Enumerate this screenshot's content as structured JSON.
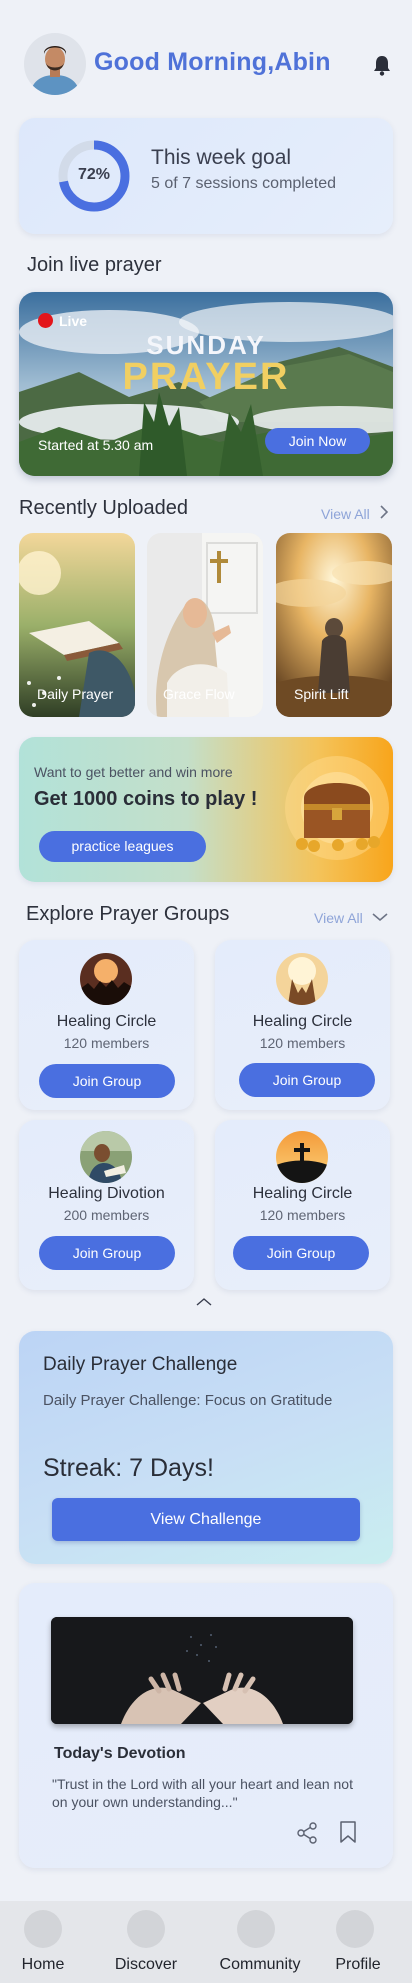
{
  "header": {
    "greeting": "Good Morning,Abin",
    "icons": {
      "avatar": "user-avatar",
      "bell": "bell-icon"
    },
    "accent_color": "#4f72d8"
  },
  "goal": {
    "percent_label": "72%",
    "progress": 0.72,
    "title": "This week goal",
    "subtitle": "5 of 7 sessions completed"
  },
  "live_prayer": {
    "section_title": "Join live prayer",
    "badge": "Live",
    "banner_line1": "SUNDAY",
    "banner_line2": "PRAYER",
    "started": "Started at 5.30 am",
    "join_label": "Join Now"
  },
  "recent": {
    "section_title": "Recently Uploaded",
    "view_all": "View All",
    "items": [
      {
        "label": "Daily Prayer"
      },
      {
        "label": "Grace Flow"
      },
      {
        "label": "Spirit Lift"
      }
    ]
  },
  "coins": {
    "small_text": "Want to get better and win more",
    "big_text": "Get 1000 coins to play !",
    "button_label": "practice leagues"
  },
  "groups": {
    "section_title": "Explore Prayer Groups",
    "view_all": "View All",
    "items": [
      {
        "name": "Healing Circle",
        "members": "120 members",
        "button": "Join Group"
      },
      {
        "name": "Healing Circle",
        "members": "120 members",
        "button": "Join Group"
      },
      {
        "name": "Healing Divotion",
        "members": "200 members",
        "button": "Join Group"
      },
      {
        "name": "Healing Circle",
        "members": "120 members",
        "button": "Join Group"
      }
    ]
  },
  "challenge": {
    "title": "Daily Prayer Challenge",
    "subtitle": "Daily Prayer Challenge: Focus on Gratitude",
    "streak": "Streak: 7 Days!",
    "button_label": "View Challenge"
  },
  "devotion": {
    "title": "Today's Devotion",
    "quote": "\"Trust in the Lord with all your heart and lean not on your own understanding...\""
  },
  "nav": {
    "items": [
      {
        "label": "Home"
      },
      {
        "label": "Discover"
      },
      {
        "label": "Community"
      },
      {
        "label": "Profile"
      }
    ]
  }
}
